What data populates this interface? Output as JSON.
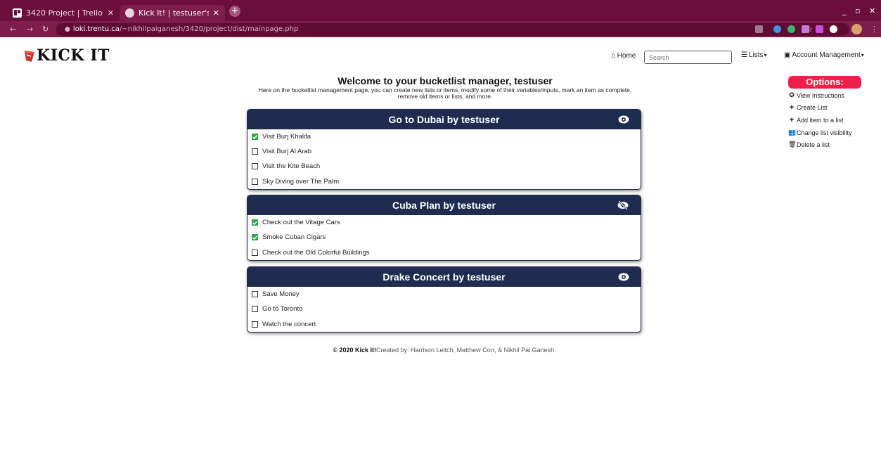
{
  "browser": {
    "tabs": [
      {
        "title": "3420 Project | Trello",
        "active": false,
        "icon": "trello-icon"
      },
      {
        "title": "Kick It! | testuser's Lists",
        "active": true,
        "icon": "globe-icon"
      }
    ],
    "url_host": "loki.trentu.ca",
    "url_path": "/~nikhilpaiganesh/3420/project/dist/mainpage.php"
  },
  "brand": {
    "name": "KICK IT"
  },
  "nav": {
    "home": "Home",
    "search_placeholder": "Search",
    "lists": "Lists",
    "account": "Account Management"
  },
  "welcome": {
    "title": "Welcome to your bucketlist manager, testuser",
    "subtitle": "Here on the bucketlist management page, you can create new lists or items, modify some of their variables/inputs, mark an item as complete, remove old items or lists, and more."
  },
  "options": {
    "title": "Options:",
    "items": [
      {
        "label": "View Instructions",
        "icon": "question-circle-icon"
      },
      {
        "label": "Create List",
        "icon": "plus-icon"
      },
      {
        "label": "Add item to a list",
        "icon": "plus-icon"
      },
      {
        "label": "Change list visibility",
        "icon": "users-icon"
      },
      {
        "label": "Delete a list",
        "icon": "trash-icon"
      }
    ]
  },
  "lists": [
    {
      "title": "Go to Dubai by testuser",
      "visibility": "visible",
      "items": [
        {
          "label": "Visit Burj Khalifa",
          "checked": true
        },
        {
          "label": "Visit Burj Al Arab",
          "checked": false
        },
        {
          "label": "Visit the Kite Beach",
          "checked": false
        },
        {
          "label": "Sky Diving over The Palm",
          "checked": false
        }
      ]
    },
    {
      "title": "Cuba Plan by testuser",
      "visibility": "hidden",
      "items": [
        {
          "label": "Check out the Vitage Cars",
          "checked": true
        },
        {
          "label": "Smoke Cuban Cigars",
          "checked": true
        },
        {
          "label": "Check out the Old Colorful Buildings",
          "checked": false
        }
      ]
    },
    {
      "title": "Drake Concert by testuser",
      "visibility": "visible",
      "items": [
        {
          "label": "Save Money",
          "checked": false
        },
        {
          "label": "Go to Toronto",
          "checked": false
        },
        {
          "label": "Watch the concert",
          "checked": false
        }
      ]
    }
  ],
  "footer": {
    "brand": "© 2020 Kick It!",
    "credits": "Created by: Harrison Leitch, Matthew Corr, & Nikhil Pai Ganesh."
  },
  "colors": {
    "browser_frame": "#6b0f3a",
    "list_header": "#1e2c4f",
    "options_accent": "#ef1f4a",
    "check_green": "#2ea84f"
  }
}
